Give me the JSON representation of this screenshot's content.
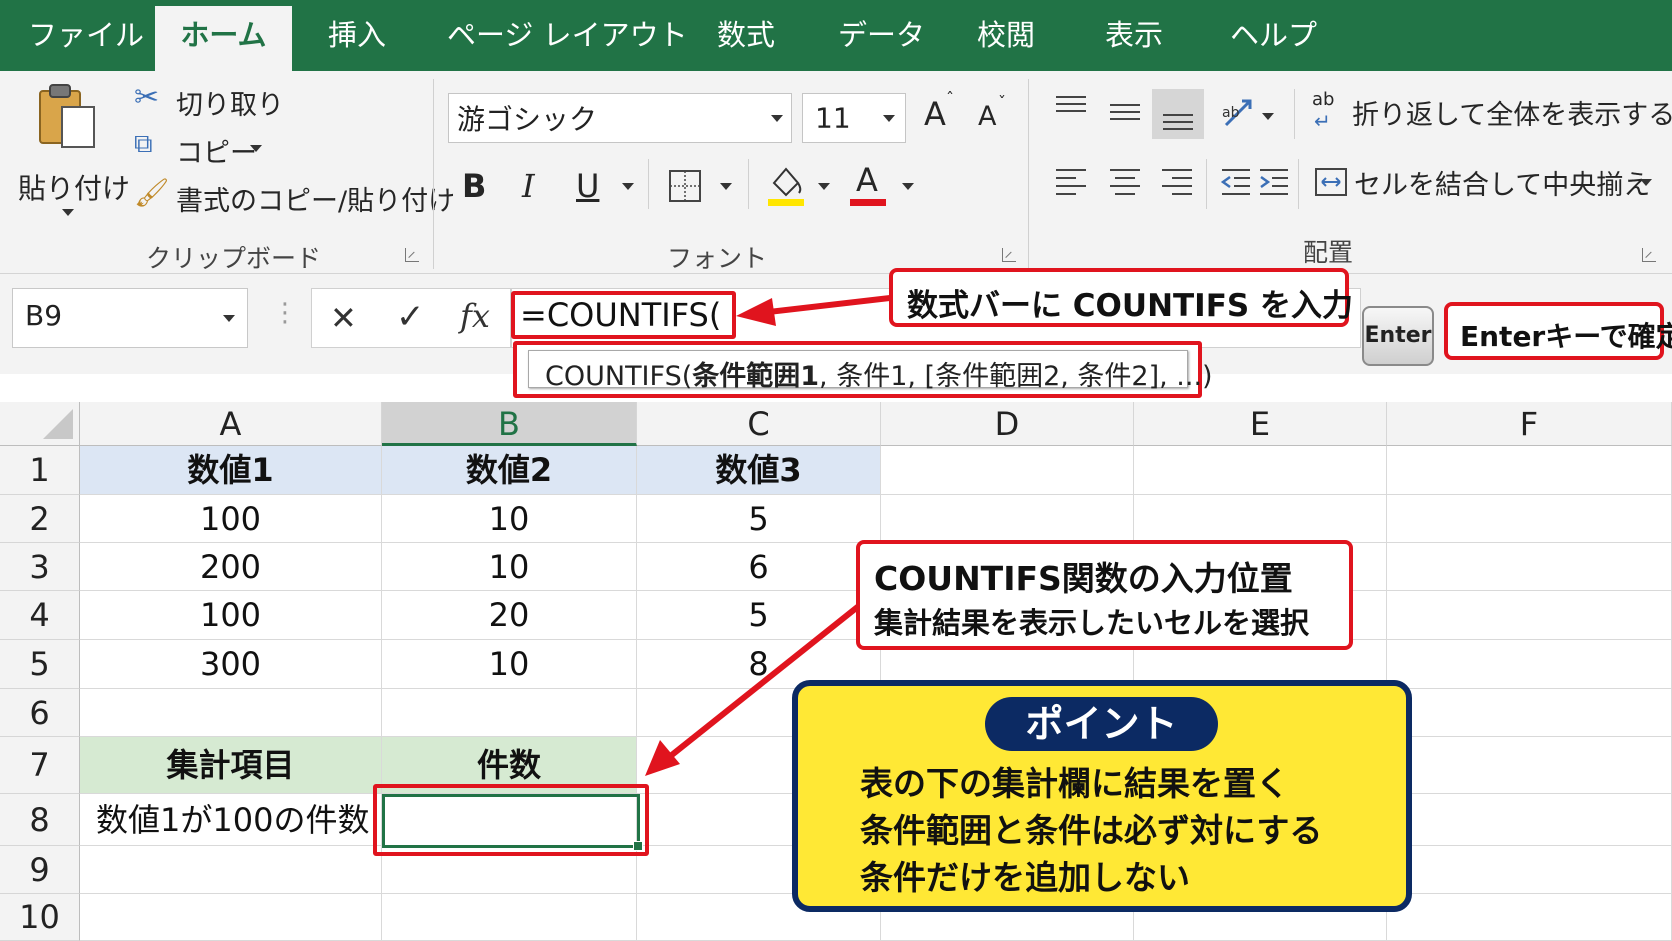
{
  "tabs": [
    "ファイル",
    "ホーム",
    "挿入",
    "ページ レイアウト",
    "数式",
    "データ",
    "校閲",
    "表示",
    "ヘルプ"
  ],
  "active_tab": "ホーム",
  "clipboard": {
    "paste": "貼り付け",
    "cut": "切り取り",
    "copy": "コピー",
    "format_painter": "書式のコピー/貼り付け",
    "group_label": "クリップボード"
  },
  "font": {
    "name": "游ゴシック",
    "size": "11",
    "bold": "B",
    "italic": "I",
    "underline": "U",
    "font_color_letter": "A",
    "grow": "A",
    "shrink": "A",
    "group_label": "フォント",
    "highlight_color": "#ffe600",
    "font_color": "#e0141e"
  },
  "alignment": {
    "wrap_text": "折り返して全体を表示する",
    "merge_center": "セルを結合して中央揃え",
    "group_label": "配置",
    "wrap_icon_text": "ab"
  },
  "formula_bar": {
    "name_box": "B9",
    "cancel": "✕",
    "confirm": "✓",
    "fx": "fx",
    "formula": "=COUNTIFS(",
    "tooltip_prefix": "COUNTIFS(",
    "tooltip_bold": "条件範囲1",
    "tooltip_rest": ", 条件1, [条件範囲2, 条件2], ...)"
  },
  "columns": [
    "A",
    "B",
    "C",
    "D",
    "E",
    "F"
  ],
  "rows": [
    "1",
    "2",
    "3",
    "4",
    "5",
    "6",
    "7",
    "8",
    "9",
    "10"
  ],
  "table": {
    "headers": [
      "数値1",
      "数値2",
      "数値3"
    ],
    "data": [
      [
        "100",
        "10",
        "5"
      ],
      [
        "200",
        "10",
        "6"
      ],
      [
        "100",
        "20",
        "5"
      ],
      [
        "300",
        "10",
        "8"
      ]
    ],
    "summary_headers": [
      "集計項目",
      "件数"
    ],
    "summary_label": "数値1が100の件数",
    "summary_value": ""
  },
  "callouts": {
    "formula_bar_note": "数式バーに COUNTIFS を入力",
    "enter_key": "Enter",
    "enter_note": "Enterキーで確定",
    "position_title": "COUNTIFS関数の入力位置",
    "position_sub": "集計結果を表示したいセルを選択",
    "point_badge": "ポイント",
    "point_lines": [
      "表の下の集計欄に結果を置く",
      "条件範囲と条件は必ず対にする",
      "条件だけを追加しない"
    ]
  },
  "colors": {
    "excel_green": "#217346",
    "header_blue": "#dce6f4",
    "summary_green": "#d6ead2",
    "callout_red": "#e0141e",
    "point_yellow": "#ffe835",
    "point_navy": "#0c2a63"
  }
}
